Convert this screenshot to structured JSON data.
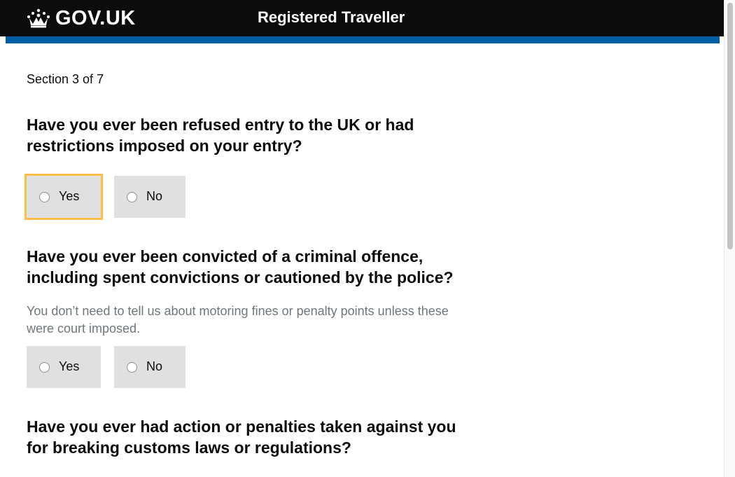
{
  "header": {
    "logo_text": "GOV.UK",
    "service_name": "Registered Traveller"
  },
  "main": {
    "section_counter": "Section 3 of 7",
    "questions": [
      {
        "text": "Have you ever been refused entry to the UK or had restrictions imposed on your entry?",
        "hint": "",
        "options": [
          "Yes",
          "No"
        ],
        "focused_option": "Yes"
      },
      {
        "text": "Have you ever been convicted of a criminal offence, including spent convictions or cautioned by the police?",
        "hint": "You don’t need to tell us about motoring fines or penalty points unless these were court imposed.",
        "options": [
          "Yes",
          "No"
        ]
      },
      {
        "text": "Have you ever had action or penalties taken against you for breaking customs laws or regulations?",
        "hint": "",
        "options": []
      }
    ]
  },
  "colors": {
    "header_bg": "#0b0c0c",
    "stripe": "#005ea5",
    "radio_bg": "#dee0e2",
    "focus": "#ffbf47",
    "hint_text": "#6f777b"
  },
  "icons": {
    "logo": "crown-icon",
    "radio": "radio-unchecked-icon"
  }
}
